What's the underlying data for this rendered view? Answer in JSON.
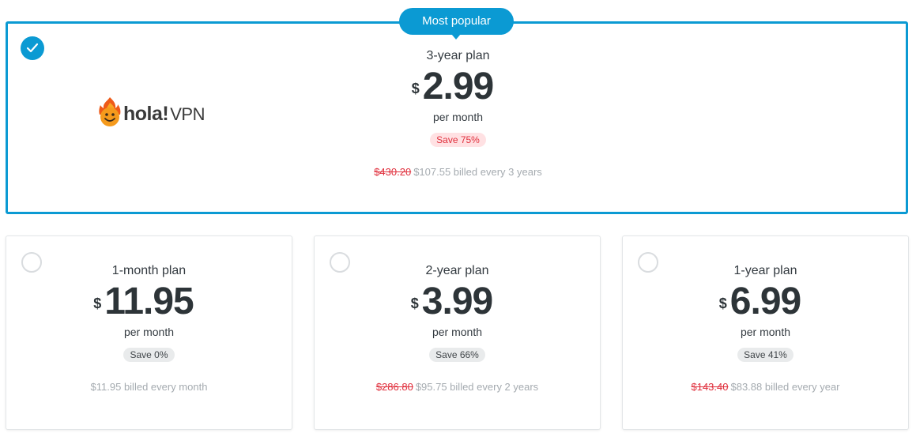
{
  "featured": {
    "badge": "Most popular",
    "plan_name": "3-year plan",
    "currency": "$",
    "price": "2.99",
    "per": "per month",
    "save": "Save 75%",
    "old_price": "$430.20",
    "billing": "$107.55 billed every 3 years",
    "logo_text": "hola!",
    "logo_suffix": "VPN"
  },
  "plans": [
    {
      "plan_name": "1-month plan",
      "currency": "$",
      "price": "11.95",
      "per": "per month",
      "save": "Save 0%",
      "old_price": "",
      "billing": "$11.95 billed every month"
    },
    {
      "plan_name": "2-year plan",
      "currency": "$",
      "price": "3.99",
      "per": "per month",
      "save": "Save 66%",
      "old_price": "$286.80",
      "billing": "$95.75 billed every 2 years"
    },
    {
      "plan_name": "1-year plan",
      "currency": "$",
      "price": "6.99",
      "per": "per month",
      "save": "Save 41%",
      "old_price": "$143.40",
      "billing": "$83.88 billed every year"
    }
  ],
  "colors": {
    "accent": "#0b9ad3",
    "save_red": "#e0303d",
    "save_red_bg": "#ffe1e3",
    "price_text": "#2d3438",
    "muted": "#a5abb0"
  },
  "icons": {
    "selected": "check-icon",
    "logo": "flame-smiley-icon"
  }
}
